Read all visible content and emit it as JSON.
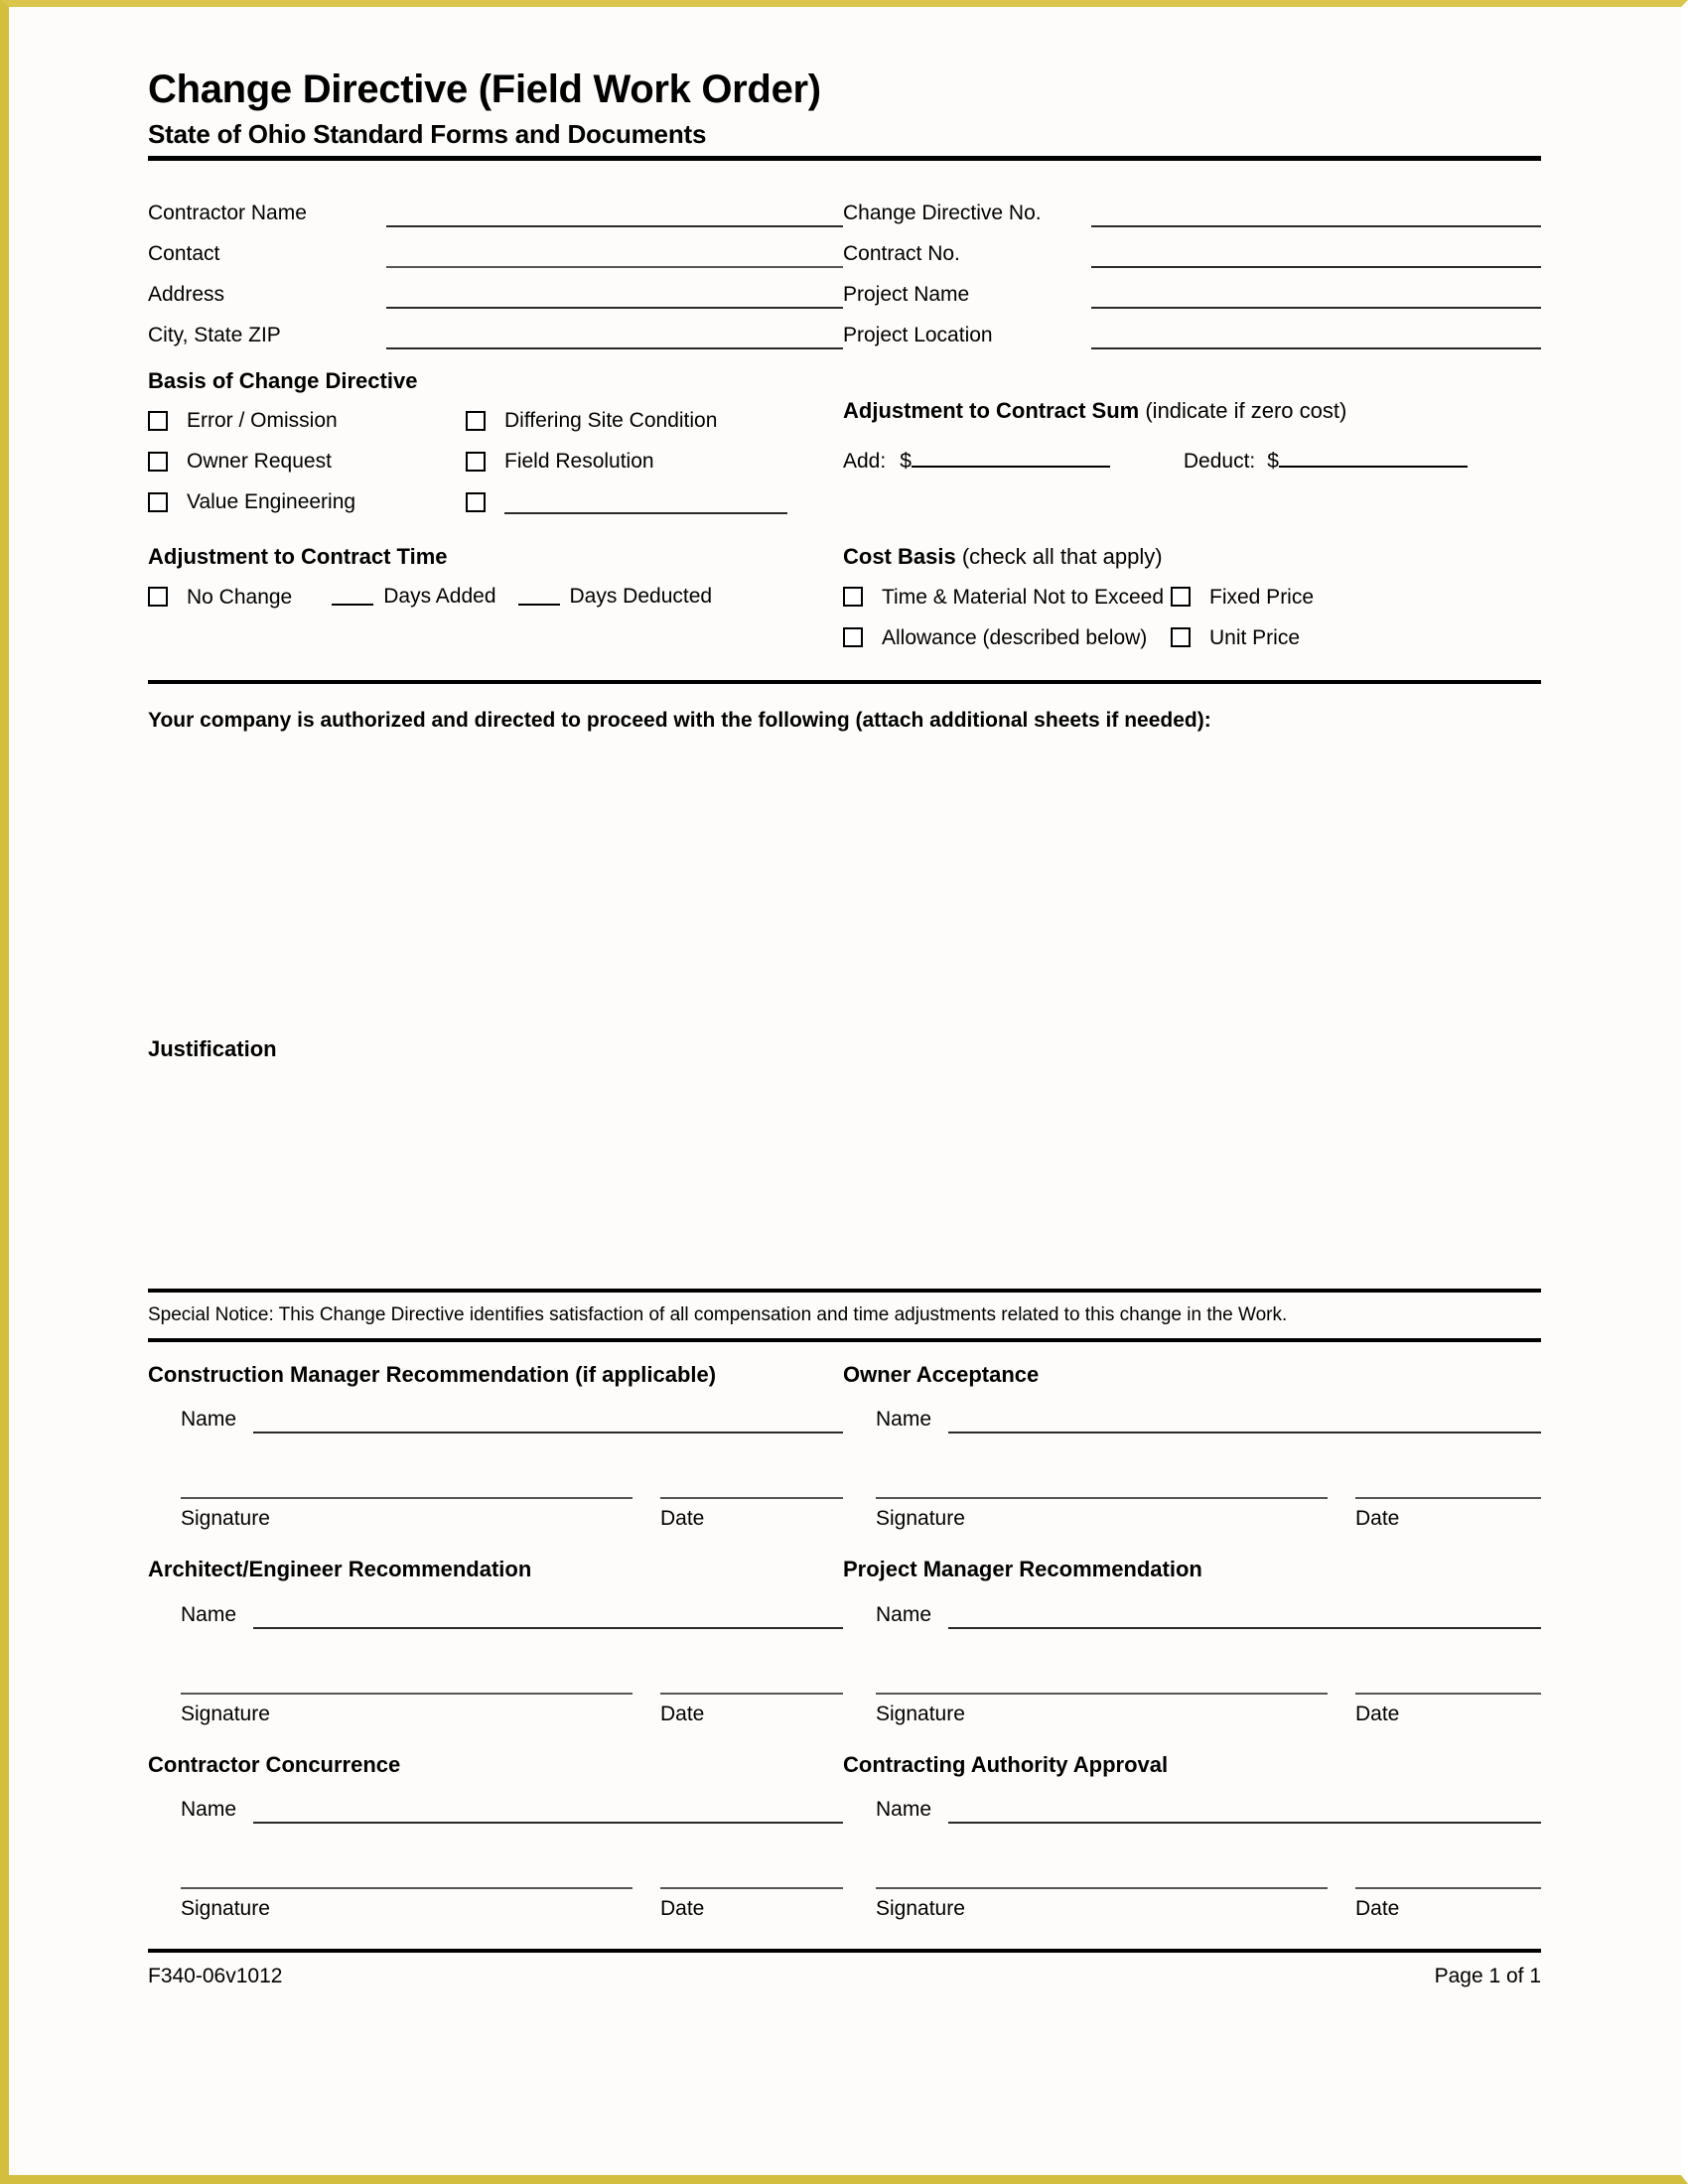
{
  "header": {
    "title": "Change Directive (Field Work Order)",
    "subtitle": "State of Ohio Standard Forms and Documents"
  },
  "party_fields": {
    "left": [
      {
        "label": "Contractor Name",
        "value": ""
      },
      {
        "label": "Contact",
        "value": ""
      },
      {
        "label": "Address",
        "value": ""
      },
      {
        "label": "City, State ZIP",
        "value": ""
      }
    ],
    "right": [
      {
        "label": "Change Directive No.",
        "value": ""
      },
      {
        "label": "Contract No.",
        "value": ""
      },
      {
        "label": "Project Name",
        "value": ""
      },
      {
        "label": "Project Location",
        "value": ""
      }
    ]
  },
  "basis": {
    "heading": "Basis of Change Directive",
    "options_left": [
      "Error / Omission",
      "Owner Request",
      "Value Engineering"
    ],
    "options_right": [
      "Differing Site Condition",
      "Field Resolution"
    ],
    "other_write_in": ""
  },
  "contract_sum": {
    "heading_bold": "Adjustment to Contract Sum",
    "heading_note": "(indicate if zero cost)",
    "add_label": "Add:",
    "add_currency": "$",
    "add_value": "",
    "deduct_label": "Deduct:",
    "deduct_currency": "$",
    "deduct_value": ""
  },
  "contract_time": {
    "heading": "Adjustment to Contract Time",
    "no_change_label": "No Change",
    "days_added_value": "",
    "days_added_label": "Days Added",
    "days_deducted_value": "",
    "days_deducted_label": "Days Deducted"
  },
  "cost_basis": {
    "heading_bold": "Cost Basis",
    "heading_note": "(check all that apply)",
    "options_left": [
      "Time & Material Not to Exceed",
      "Allowance (described below)"
    ],
    "options_right": [
      "Fixed Price",
      "Unit Price"
    ]
  },
  "authorization": {
    "statement": "Your company is authorized and directed to proceed with the following (attach additional sheets if needed):",
    "work_description": "",
    "justification_label": "Justification",
    "justification_text": ""
  },
  "special_notice": {
    "text": "Special Notice: This Change Directive identifies satisfaction of all compensation and time adjustments related to this change in the Work."
  },
  "signature_labels": {
    "name": "Name",
    "signature": "Signature",
    "date": "Date"
  },
  "signature_blocks": [
    {
      "heading_bold": "Construction Manager Recommendation",
      "heading_note": "(if applicable)",
      "name_value": "",
      "signature_value": "",
      "date_value": ""
    },
    {
      "heading_bold": "Owner Acceptance",
      "heading_note": "",
      "name_value": "",
      "signature_value": "",
      "date_value": ""
    },
    {
      "heading_bold": "Architect/Engineer Recommendation",
      "heading_note": "",
      "name_value": "",
      "signature_value": "",
      "date_value": ""
    },
    {
      "heading_bold": "Project Manager Recommendation",
      "heading_note": "",
      "name_value": "",
      "signature_value": "",
      "date_value": ""
    },
    {
      "heading_bold": "Contractor Concurrence",
      "heading_note": "",
      "name_value": "",
      "signature_value": "",
      "date_value": ""
    },
    {
      "heading_bold": "Contracting Authority Approval",
      "heading_note": "",
      "name_value": "",
      "signature_value": "",
      "date_value": ""
    }
  ],
  "footer": {
    "form_number": "F340-06v1012",
    "page_indicator": "Page 1 of 1"
  },
  "colors": {
    "page_border": "#d4be3e",
    "paper": "#fdfcfa",
    "ink": "#000000",
    "rule": "#2a2a2a"
  }
}
